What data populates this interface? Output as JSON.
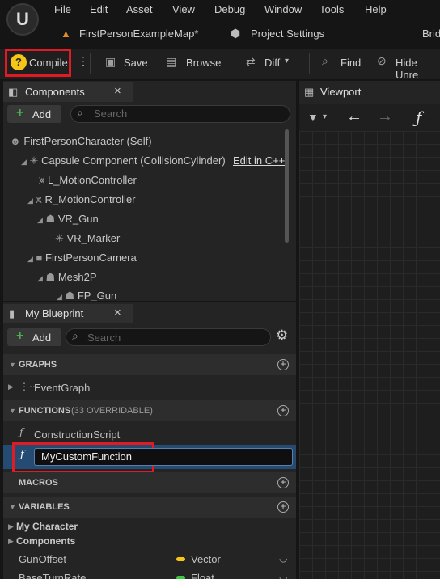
{
  "menu": {
    "logo": "U",
    "items": [
      "File",
      "Edit",
      "Asset",
      "View",
      "Debug",
      "Window",
      "Tools",
      "Help"
    ]
  },
  "tabs": {
    "map": "FirstPersonExampleMap*",
    "project_settings": "Project Settings",
    "bridge": "Brid"
  },
  "toolbar": {
    "compile": "Compile",
    "save": "Save",
    "browse": "Browse",
    "diff": "Diff",
    "find": "Find",
    "hide": "Hide Unre"
  },
  "components": {
    "title": "Components",
    "add": "Add",
    "search_placeholder": "Search",
    "tree": [
      {
        "label": "FirstPersonCharacter (Self)"
      },
      {
        "label": "Capsule Component (CollisionCylinder)",
        "link": "Edit in C++"
      },
      {
        "label": "L_MotionController"
      },
      {
        "label": "R_MotionController"
      },
      {
        "label": "VR_Gun"
      },
      {
        "label": "VR_Marker"
      },
      {
        "label": "FirstPersonCamera"
      },
      {
        "label": "Mesh2P"
      },
      {
        "label": "FP_Gun"
      }
    ]
  },
  "blueprint": {
    "title": "My Blueprint",
    "add": "Add",
    "search_placeholder": "Search",
    "graphs_header": "GRAPHS",
    "event_graph": "EventGraph",
    "functions_header": "FUNCTIONS",
    "functions_sub": "(33 OVERRIDABLE)",
    "construction_script": "ConstructionScript",
    "new_function_value": "MyCustomFunction",
    "macros_header": "MACROS",
    "variables_header": "VARIABLES",
    "var_categories": [
      "My Character",
      "Components"
    ],
    "variables": [
      {
        "name": "GunOffset",
        "type": "Vector",
        "color": "#f5c518"
      },
      {
        "name": "BaseTurnRate",
        "type": "Float",
        "color": "#3cc83c"
      }
    ]
  },
  "viewport": {
    "title": "Viewport"
  },
  "colors": {
    "accent_red": "#e01b24",
    "selected_row": "#264b73"
  }
}
